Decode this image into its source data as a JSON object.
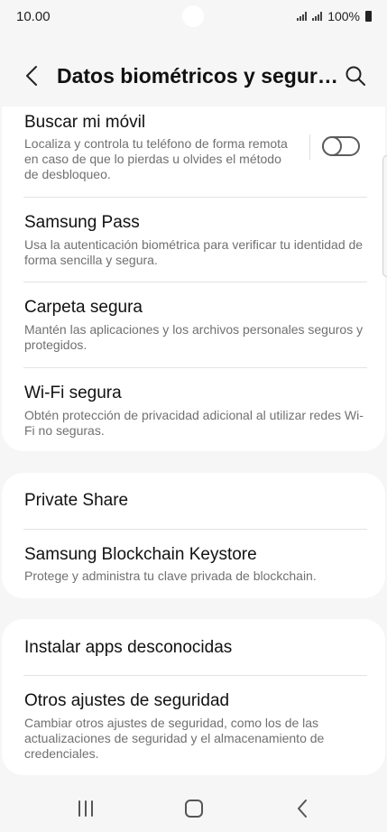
{
  "status": {
    "time": "10.00",
    "battery": "100%"
  },
  "header": {
    "title": "Datos biométricos y seguri…"
  },
  "cards": {
    "card1": [
      {
        "title": "Buscar mi móvil",
        "desc": "Localiza y controla tu teléfono de forma remota en caso de que lo pierdas u olvides el método de desbloqueo.",
        "toggle_on": false
      },
      {
        "title": "Samsung Pass",
        "desc": "Usa la autenticación biométrica para verificar tu identidad de forma sencilla y segura."
      },
      {
        "title": "Carpeta segura",
        "desc": "Mantén las aplicaciones y los archivos personales seguros y protegidos."
      },
      {
        "title": "Wi-Fi segura",
        "desc": "Obtén protección de privacidad adicional al utilizar redes Wi-Fi no seguras."
      }
    ],
    "card2": [
      {
        "title": "Private Share"
      },
      {
        "title": "Samsung Blockchain Keystore",
        "desc": "Protege y administra tu clave privada de blockchain."
      }
    ],
    "card3": [
      {
        "title": "Instalar apps desconocidas"
      },
      {
        "title": "Otros ajustes de seguridad",
        "desc": "Cambiar otros ajustes de seguridad, como los de las actualizaciones de seguridad y el almacenamiento de credenciales."
      }
    ]
  },
  "icons": {
    "back": "chevron-left-icon",
    "search": "search-icon",
    "nav_recents": "recents-icon",
    "nav_home": "home-icon",
    "nav_back": "back-icon"
  },
  "colors": {
    "background": "#f6f6f6",
    "card": "#ffffff",
    "title": "#111111",
    "description": "#707070",
    "divider": "#e3e3e3"
  }
}
